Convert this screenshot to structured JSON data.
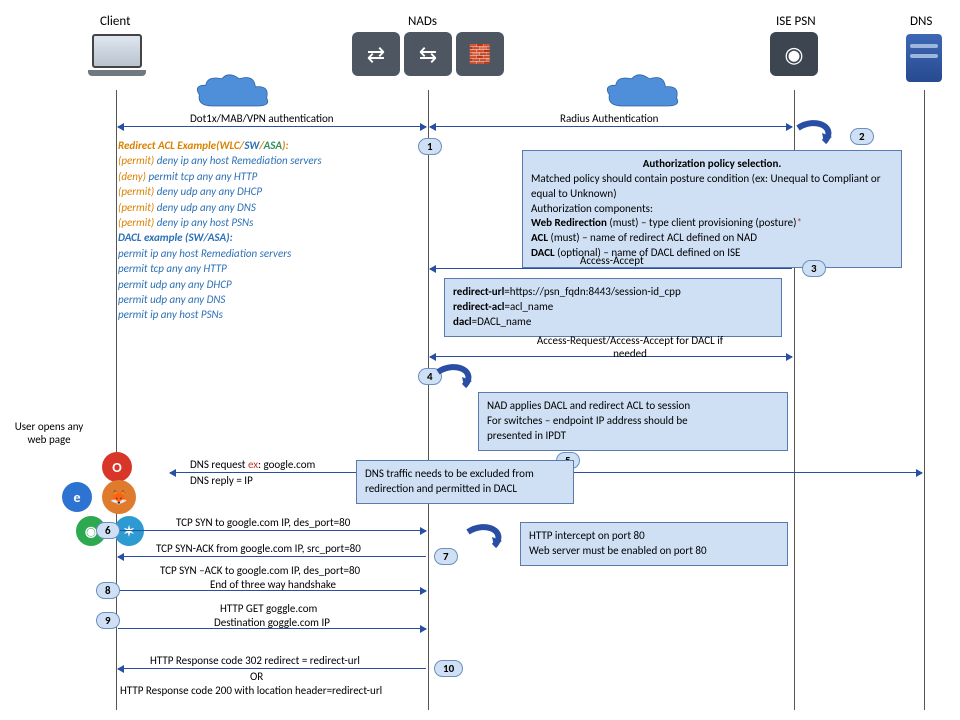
{
  "lanes": {
    "client": "Client",
    "nads": "NADs",
    "ise": "ISE PSN",
    "dns": "DNS"
  },
  "top_msgs": {
    "auth_left": "Dot1x/MAB/VPN  authentication",
    "auth_right": "Radius Authentication"
  },
  "acl": {
    "title1_pre": "Redirect ACL Example(",
    "title1_wlc": "WLC",
    "title1_sep": "/",
    "title1_sw": "SW",
    "title1_asa": "ASA",
    "title1_post": "):",
    "l1a": "(permit)",
    "l1b": "deny",
    "l1c": " ip any host Remediation servers",
    "l2a": "(deny)",
    "l2b": "permit",
    "l2c": " tcp any any HTTP",
    "l3a": "(permit)",
    "l3b": "deny",
    "l3c": " udp any any  DHCP",
    "l4a": "(permit)",
    "l4b": "deny",
    "l4c": " udp any any DNS",
    "l5a": "(permit)",
    "l5b": "deny",
    "l5c": " ip any host PSNs",
    "title2": "DACL example (SW/ASA):",
    "d1": "permit ip any host Remediation servers",
    "d2": "permit tcp any any HTTP",
    "d3": "permit udp any any  DHCP",
    "d4": "permit udp any any DNS",
    "d5": "permit ip any host PSNs"
  },
  "steps": {
    "s1": "1",
    "s2": "2",
    "s3": "3",
    "s4": "4",
    "s5": "5",
    "s6": "6",
    "s7": "7",
    "s8": "8",
    "s9": "9",
    "s10": "10"
  },
  "auth_panel": {
    "title": "Authorization  policy selection.",
    "l1": "Matched policy should contain posture condition (ex: Unequal to Compliant or equal to Unknown)",
    "l2": "Authorization components:",
    "l3a": "Web Redirection",
    "l3b": " (must) – type client provisioning (posture)",
    "l4a": "ACL",
    "l4b": " (must) – name of redirect ACL defined on NAD",
    "l5a": "DACL",
    "l5b": " (optional) – name of DACL defined on ISE"
  },
  "access_accept": "Access-Accept",
  "redirect_panel": {
    "l1a": "redirect-url",
    "l1b": "=https://psn_fqdn:8443/session-id_cpp",
    "l2a": "redirect-acl",
    "l2b": "=acl_name",
    "l3a": "dacl",
    "l3b": "=DACL_name"
  },
  "dacl_req": "Access-Request/Access-Accept for DACL if needed",
  "apply_panel": {
    "l1": "NAD applies DACL and redirect ACL to session",
    "l2": "For switches – endpoint IP address should be",
    "l3": "presented in IPDT"
  },
  "dns_note_panel": "DNS traffic needs to be excluded from redirection and permitted in DACL",
  "user_open": "User opens any web page",
  "dns_req_pre": "DNS request ",
  "dns_req_ex": "ex",
  "dns_req_post": ": google.com",
  "dns_reply": "DNS reply = IP",
  "tcp1": "TCP SYN to google.com IP, des_port=80",
  "tcp2": "TCP SYN-ACK  from google.com IP, src_port=80",
  "tcp3": "TCP SYN –ACK to google.com IP, des_port=80",
  "tcp3b": "End of three way handshake",
  "http_intercept": {
    "l1": "HTTP intercept on port 80",
    "l2": "Web server must be enabled on port 80"
  },
  "http_get": "HTTP GET goggle.com",
  "http_get2": "Destination goggle.com IP",
  "resp1": "HTTP Response code 302 redirect = redirect-url",
  "or": "OR",
  "resp2": "HTTP Response code 200 with location header=redirect-url"
}
